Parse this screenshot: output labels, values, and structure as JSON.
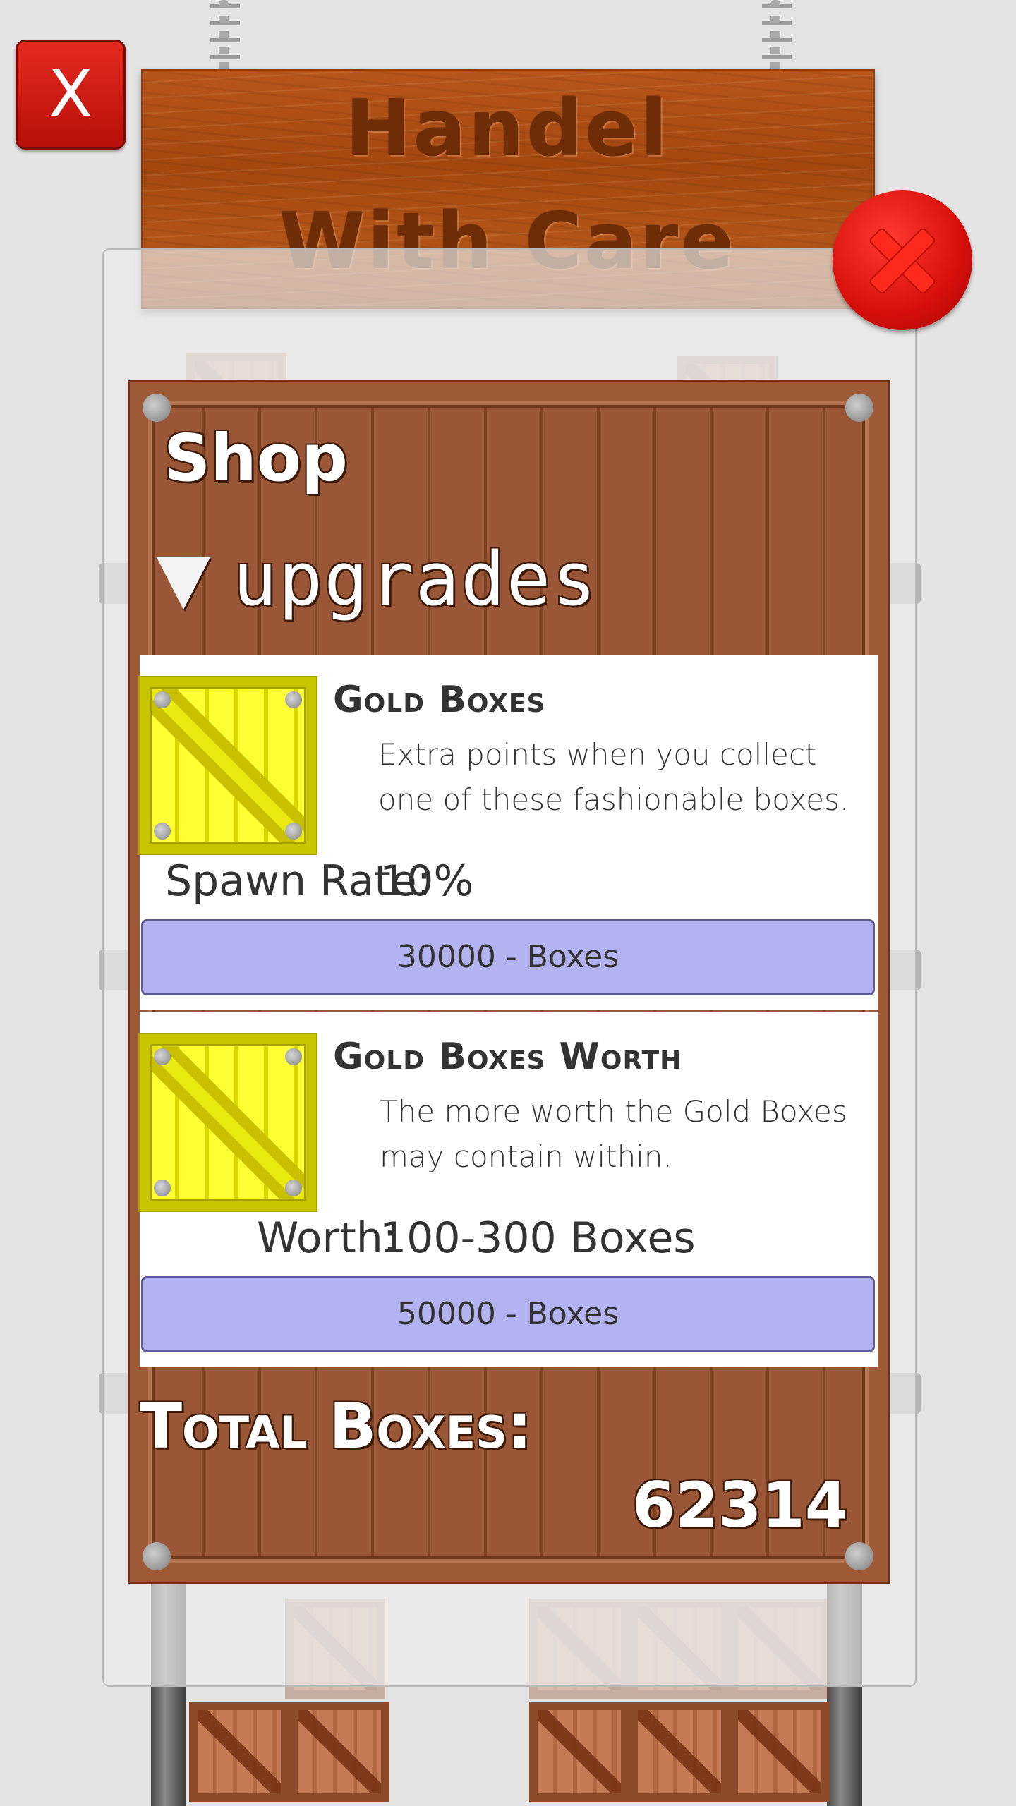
{
  "sign": {
    "line1": "Handel",
    "line2": "With Care"
  },
  "close_small": {
    "label": "X"
  },
  "shop": {
    "title": "Shop",
    "section": "upgrades",
    "items": [
      {
        "title": "Gold Boxes",
        "description": "Extra points when you collect one of these fashionable boxes.",
        "stat_label": "Spawn Rate:",
        "stat_value": "10%",
        "price_label": "30000 - Boxes"
      },
      {
        "title": "Gold Boxes Worth",
        "description": "The more worth the Gold Boxes may contain within.",
        "stat_label": "Worth:",
        "stat_value": "100-300 Boxes",
        "price_label": "50000 - Boxes"
      }
    ],
    "total_label": "Total Boxes:",
    "total_value": "62314"
  },
  "colors": {
    "board_wood": "#9a5737",
    "button_fill": "#b3b3f1",
    "close_red": "#d60f0b",
    "gold_crate": "#ffff33"
  }
}
